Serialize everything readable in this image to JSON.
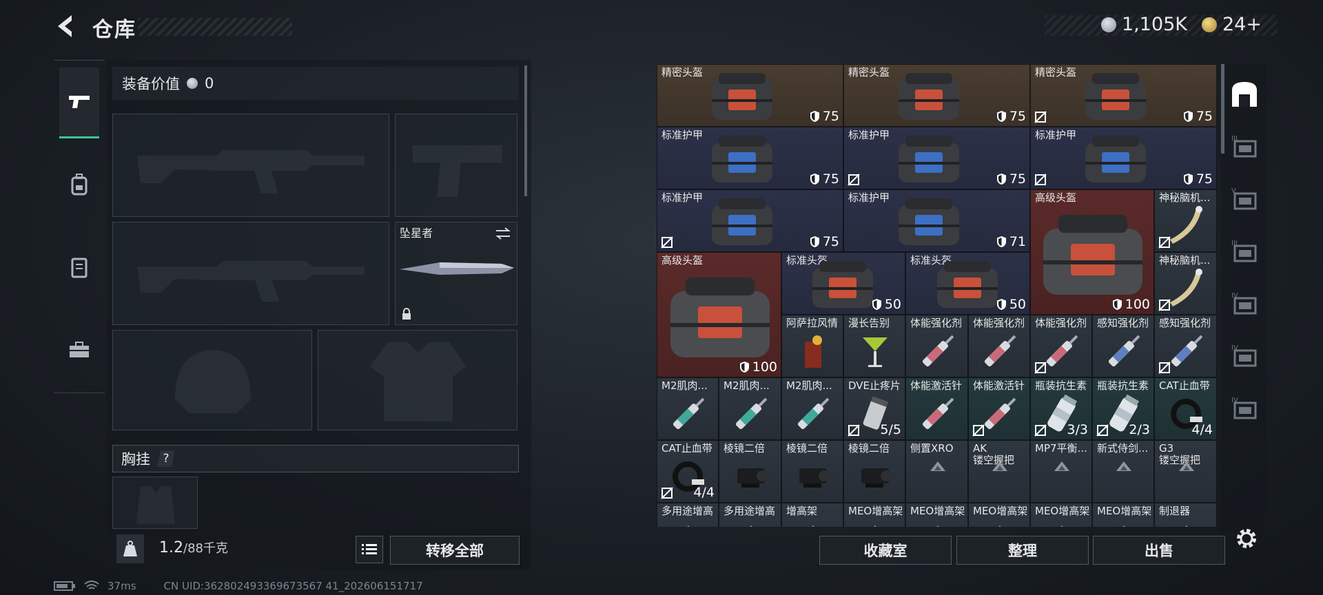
{
  "header": {
    "title": "仓库"
  },
  "currency": [
    {
      "icon": "silver-coin-icon",
      "value": "1,105K"
    },
    {
      "icon": "gold-triangle-coin-icon",
      "value": "24+"
    }
  ],
  "left": {
    "tabs": [
      {
        "icon": "gun-icon",
        "active": true
      },
      {
        "icon": "backpack-icon",
        "active": false
      },
      {
        "icon": "vest-icon",
        "active": false
      },
      {
        "icon": "toolbox-icon",
        "active": false
      }
    ],
    "equip_value_label": "装备价值",
    "equip_value": "0",
    "melee_name": "坠星者",
    "chest_rig_label": "胸挂",
    "chest_rig_help": "?",
    "weight_current": "1.2",
    "weight_max": "/88千克",
    "transfer_all": "转移全部"
  },
  "grid": {
    "items": [
      {
        "name": "精密头盔",
        "value": "75",
        "bg": "brown",
        "c": 0,
        "r": 0,
        "w": 3,
        "h": 1,
        "kind": "helmet",
        "nodeco": false
      },
      {
        "name": "精密头盔",
        "value": "75",
        "bg": "brown",
        "c": 3,
        "r": 0,
        "w": 3,
        "h": 1,
        "kind": "helmet",
        "nodeco": false
      },
      {
        "name": "精密头盔",
        "value": "75",
        "bg": "brown",
        "c": 6,
        "r": 0,
        "w": 3,
        "h": 1,
        "kind": "helmet",
        "nodeco": true
      },
      {
        "name": "标准护甲",
        "value": "75",
        "bg": "navy",
        "c": 0,
        "r": 1,
        "w": 3,
        "h": 1,
        "kind": "armor",
        "nodeco": false
      },
      {
        "name": "标准护甲",
        "value": "75",
        "bg": "navy",
        "c": 3,
        "r": 1,
        "w": 3,
        "h": 1,
        "kind": "armor",
        "nodeco": true
      },
      {
        "name": "标准护甲",
        "value": "75",
        "bg": "navy",
        "c": 6,
        "r": 1,
        "w": 3,
        "h": 1,
        "kind": "armor",
        "nodeco": true
      },
      {
        "name": "标准护甲",
        "value": "75",
        "bg": "navy",
        "c": 0,
        "r": 2,
        "w": 3,
        "h": 1,
        "kind": "armor",
        "nodeco": true
      },
      {
        "name": "标准护甲",
        "value": "71",
        "bg": "navy",
        "c": 3,
        "r": 2,
        "w": 3,
        "h": 1,
        "kind": "armor",
        "nodeco": false
      },
      {
        "name": "高级头盔",
        "value": "100",
        "bg": "red",
        "c": 6,
        "r": 2,
        "w": 2,
        "h": 2,
        "kind": "helmet-big",
        "nodeco": false
      },
      {
        "name": "神秘脑机...",
        "value": "",
        "bg": "slate",
        "c": 8,
        "r": 2,
        "w": 1,
        "h": 1,
        "kind": "horn",
        "nodeco": true
      },
      {
        "name": "高级头盔",
        "value": "100",
        "bg": "red",
        "c": 0,
        "r": 3,
        "w": 2,
        "h": 2,
        "kind": "helmet-big",
        "nodeco": false
      },
      {
        "name": "标准头盔",
        "value": "50",
        "bg": "navy",
        "c": 2,
        "r": 3,
        "w": 2,
        "h": 1,
        "kind": "helmet",
        "nodeco": false
      },
      {
        "name": "标准头盔",
        "value": "50",
        "bg": "navy",
        "c": 4,
        "r": 3,
        "w": 2,
        "h": 1,
        "kind": "helmet",
        "nodeco": false
      },
      {
        "name": "神秘脑机...",
        "value": "",
        "bg": "slate",
        "c": 8,
        "r": 3,
        "w": 1,
        "h": 1,
        "kind": "horn",
        "nodeco": true
      },
      {
        "name": "阿萨拉风情",
        "value": "",
        "bg": "slate",
        "c": 2,
        "r": 4,
        "w": 1,
        "h": 1,
        "kind": "drink-red",
        "nodeco": false
      },
      {
        "name": "漫长告别",
        "value": "",
        "bg": "slate",
        "c": 3,
        "r": 4,
        "w": 1,
        "h": 1,
        "kind": "drink-green",
        "nodeco": false
      },
      {
        "name": "体能强化剂",
        "value": "",
        "bg": "slate",
        "c": 4,
        "r": 4,
        "w": 1,
        "h": 1,
        "kind": "syringe-pink",
        "nodeco": false
      },
      {
        "name": "体能强化剂",
        "value": "",
        "bg": "slate",
        "c": 5,
        "r": 4,
        "w": 1,
        "h": 1,
        "kind": "syringe-pink",
        "nodeco": false
      },
      {
        "name": "体能强化剂",
        "value": "",
        "bg": "slate",
        "c": 6,
        "r": 4,
        "w": 1,
        "h": 1,
        "kind": "syringe-pink",
        "nodeco": true
      },
      {
        "name": "感知强化剂",
        "value": "",
        "bg": "slate",
        "c": 7,
        "r": 4,
        "w": 1,
        "h": 1,
        "kind": "syringe-blue",
        "nodeco": false
      },
      {
        "name": "感知强化剂",
        "value": "",
        "bg": "slate",
        "c": 8,
        "r": 4,
        "w": 1,
        "h": 1,
        "kind": "syringe-blue",
        "nodeco": true
      },
      {
        "name": "M2肌肉...",
        "value": "",
        "bg": "slate",
        "c": 0,
        "r": 5,
        "w": 1,
        "h": 1,
        "kind": "syringe-teal",
        "nodeco": false
      },
      {
        "name": "M2肌肉...",
        "value": "",
        "bg": "slate",
        "c": 1,
        "r": 5,
        "w": 1,
        "h": 1,
        "kind": "syringe-teal",
        "nodeco": false
      },
      {
        "name": "M2肌肉...",
        "value": "",
        "bg": "slate",
        "c": 2,
        "r": 5,
        "w": 1,
        "h": 1,
        "kind": "syringe-teal",
        "nodeco": false
      },
      {
        "name": "DVE止疼片",
        "value": "5/5",
        "bg": "slate",
        "c": 3,
        "r": 5,
        "w": 1,
        "h": 1,
        "kind": "pills",
        "nodeco": true
      },
      {
        "name": "体能激活针",
        "value": "",
        "bg": "teal",
        "c": 4,
        "r": 5,
        "w": 1,
        "h": 1,
        "kind": "syringe-pink",
        "nodeco": false
      },
      {
        "name": "体能激活针",
        "value": "",
        "bg": "teal",
        "c": 5,
        "r": 5,
        "w": 1,
        "h": 1,
        "kind": "syringe-pink",
        "nodeco": true
      },
      {
        "name": "瓶装抗生素",
        "value": "3/3",
        "bg": "teal",
        "c": 6,
        "r": 5,
        "w": 1,
        "h": 1,
        "kind": "bottle",
        "nodeco": true
      },
      {
        "name": "瓶装抗生素",
        "value": "2/3",
        "bg": "teal",
        "c": 7,
        "r": 5,
        "w": 1,
        "h": 1,
        "kind": "bottle",
        "nodeco": true
      },
      {
        "name": "CAT止血带",
        "value": "4/4",
        "bg": "teal",
        "c": 8,
        "r": 5,
        "w": 1,
        "h": 1,
        "kind": "tourniquet",
        "nodeco": false
      },
      {
        "name": "CAT止血带",
        "value": "4/4",
        "bg": "slate",
        "c": 0,
        "r": 6,
        "w": 1,
        "h": 1,
        "kind": "tourniquet",
        "nodeco": true
      },
      {
        "name": "棱镜二倍",
        "value": "",
        "bg": "slate",
        "c": 1,
        "r": 6,
        "w": 1,
        "h": 1,
        "kind": "scope",
        "nodeco": false
      },
      {
        "name": "棱镜二倍",
        "value": "",
        "bg": "slate",
        "c": 2,
        "r": 6,
        "w": 1,
        "h": 1,
        "kind": "scope",
        "nodeco": false
      },
      {
        "name": "棱镜二倍",
        "value": "",
        "bg": "slate",
        "c": 3,
        "r": 6,
        "w": 1,
        "h": 1,
        "kind": "scope",
        "nodeco": false
      },
      {
        "name": "侧置XRO",
        "value": "",
        "bg": "slate",
        "c": 4,
        "r": 6,
        "w": 1,
        "h": 1,
        "kind": "placeholder",
        "nodeco": false
      },
      {
        "name": "AK\n镂空握把",
        "value": "",
        "bg": "slate",
        "c": 5,
        "r": 6,
        "w": 1,
        "h": 1,
        "kind": "placeholder",
        "nodeco": false
      },
      {
        "name": "MP7平衡...",
        "value": "",
        "bg": "slate",
        "c": 6,
        "r": 6,
        "w": 1,
        "h": 1,
        "kind": "placeholder",
        "nodeco": false
      },
      {
        "name": "新式侍剑...",
        "value": "",
        "bg": "slate",
        "c": 7,
        "r": 6,
        "w": 1,
        "h": 1,
        "kind": "placeholder",
        "nodeco": false
      },
      {
        "name": "G3\n镂空握把",
        "value": "",
        "bg": "slate",
        "c": 8,
        "r": 6,
        "w": 1,
        "h": 1,
        "kind": "placeholder",
        "nodeco": false
      },
      {
        "name": "多用途增高",
        "value": "",
        "bg": "slate",
        "c": 0,
        "r": 7,
        "w": 1,
        "h": 1,
        "kind": "placeholder",
        "nodeco": false
      },
      {
        "name": "多用途增高",
        "value": "",
        "bg": "slate",
        "c": 1,
        "r": 7,
        "w": 1,
        "h": 1,
        "kind": "placeholder",
        "nodeco": false
      },
      {
        "name": "增高架",
        "value": "",
        "bg": "slate",
        "c": 2,
        "r": 7,
        "w": 1,
        "h": 1,
        "kind": "placeholder",
        "nodeco": false
      },
      {
        "name": "MEO增高架",
        "value": "",
        "bg": "slate",
        "c": 3,
        "r": 7,
        "w": 1,
        "h": 1,
        "kind": "placeholder",
        "nodeco": false
      },
      {
        "name": "MEO增高架",
        "value": "",
        "bg": "slate",
        "c": 4,
        "r": 7,
        "w": 1,
        "h": 1,
        "kind": "placeholder",
        "nodeco": false
      },
      {
        "name": "MEO增高架",
        "value": "",
        "bg": "slate",
        "c": 5,
        "r": 7,
        "w": 1,
        "h": 1,
        "kind": "placeholder",
        "nodeco": false
      },
      {
        "name": "MEO增高架",
        "value": "",
        "bg": "slate",
        "c": 6,
        "r": 7,
        "w": 1,
        "h": 1,
        "kind": "placeholder",
        "nodeco": false
      },
      {
        "name": "MEO增高架",
        "value": "",
        "bg": "slate",
        "c": 7,
        "r": 7,
        "w": 1,
        "h": 1,
        "kind": "placeholder",
        "nodeco": false
      },
      {
        "name": "制退器",
        "value": "",
        "bg": "slate",
        "c": 8,
        "r": 7,
        "w": 1,
        "h": 1,
        "kind": "placeholder",
        "nodeco": false
      }
    ]
  },
  "actions": {
    "collection": "收藏室",
    "organize": "整理",
    "sell": "出售"
  },
  "rail": {
    "tabs": [
      {
        "icon": "storage-icon",
        "label": ""
      },
      {
        "icon": "tier-3-storage-icon",
        "label": "III"
      },
      {
        "icon": "tier-5-storage-icon",
        "label": "V"
      },
      {
        "icon": "tier-3b-storage-icon",
        "label": "III"
      },
      {
        "icon": "tier-4-storage-icon",
        "label": "IV"
      },
      {
        "icon": "tier-4b-storage-icon",
        "label": "IV"
      },
      {
        "icon": "tier-4c-storage-icon",
        "label": "IV"
      }
    ]
  },
  "status": {
    "ping": "37ms",
    "uid": "CN UID:362802493369673567 41_202606151717"
  }
}
